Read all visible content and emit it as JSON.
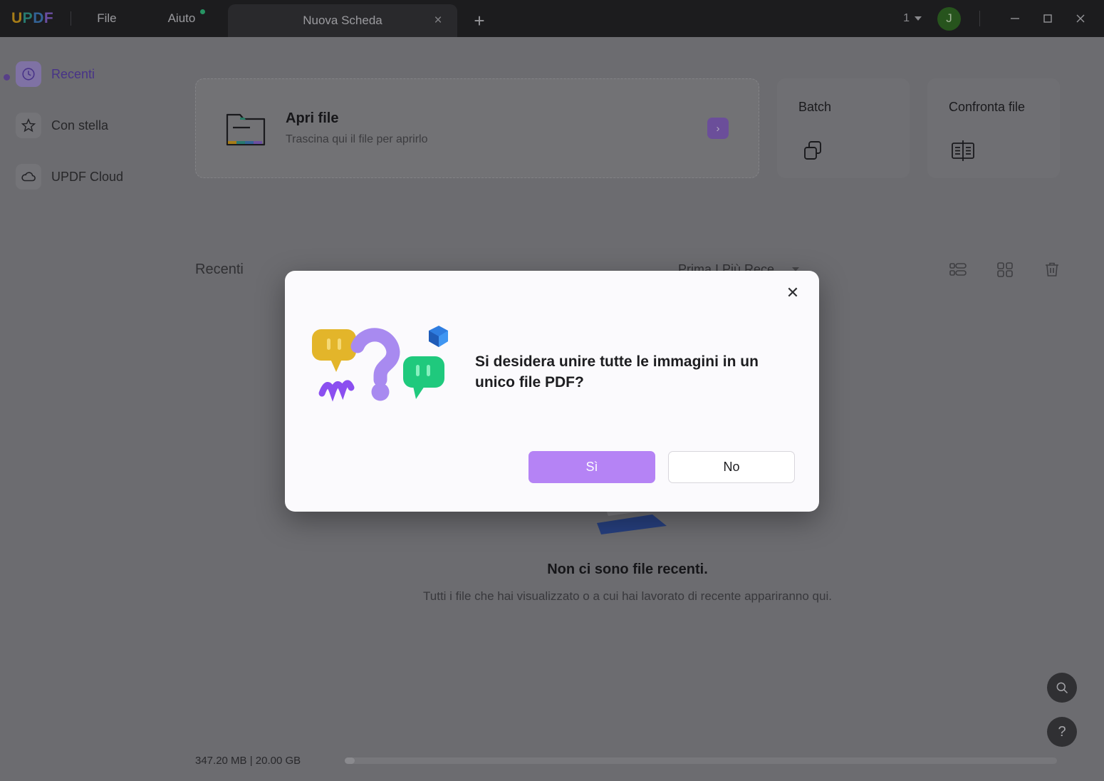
{
  "titlebar": {
    "logo": {
      "l1": "U",
      "l2": "P",
      "l3": "D",
      "l4": "F"
    },
    "menus": [
      {
        "label": "File",
        "has_dot": false
      },
      {
        "label": "Aiuto",
        "has_dot": true
      }
    ],
    "tab": {
      "label": "Nuova Scheda",
      "close_icon": "×"
    },
    "new_tab_icon": "+",
    "page_count": "1",
    "avatar_initial": "J",
    "window_controls": {
      "minimize": "—",
      "maximize": "☐",
      "close": "✕"
    }
  },
  "sidebar": {
    "items": [
      {
        "label": "Recenti",
        "icon": "clock-icon",
        "active": true
      },
      {
        "label": "Con stella",
        "icon": "star-icon",
        "active": false
      },
      {
        "label": "UPDF Cloud",
        "icon": "cloud-icon",
        "active": false
      }
    ]
  },
  "main": {
    "open_card": {
      "title": "Apri file",
      "subtitle": "Trascina qui il file per aprirlo",
      "go_icon": "›"
    },
    "quick_cards": [
      {
        "title": "Batch",
        "icon": "stacked-squares-icon"
      },
      {
        "title": "Confronta file",
        "icon": "compare-documents-icon"
      }
    ],
    "recents_header": {
      "title": "Recenti",
      "sort_label": "Prima I Più Rece...",
      "icons": [
        "list-view-icon",
        "grid-view-icon",
        "trash-icon"
      ]
    },
    "empty_state": {
      "title": "Non ci sono file recenti.",
      "subtitle": "Tutti i file che hai visualizzato o a cui hai lavorato di recente appariranno qui."
    },
    "storage": {
      "label": "347.20 MB | 20.00 GB",
      "used_mb": 347.2,
      "total_gb": 20.0
    },
    "fabs": [
      {
        "icon": "search-icon"
      },
      {
        "icon": "help-icon",
        "glyph": "?"
      }
    ]
  },
  "modal": {
    "close_icon": "✕",
    "message": "Si desidera unire tutte le immagini in un unico file PDF?",
    "buttons": {
      "yes": "Sì",
      "no": "No"
    },
    "illustration": "question-mark-chat-bubbles"
  },
  "colors": {
    "accent_purple": "#b583f5",
    "sidebar_bg": "#8b8b8f",
    "titlebar_bg": "#1f1f21",
    "modal_bg": "#fbfafd",
    "avatar_green": "#2f6b1f"
  }
}
